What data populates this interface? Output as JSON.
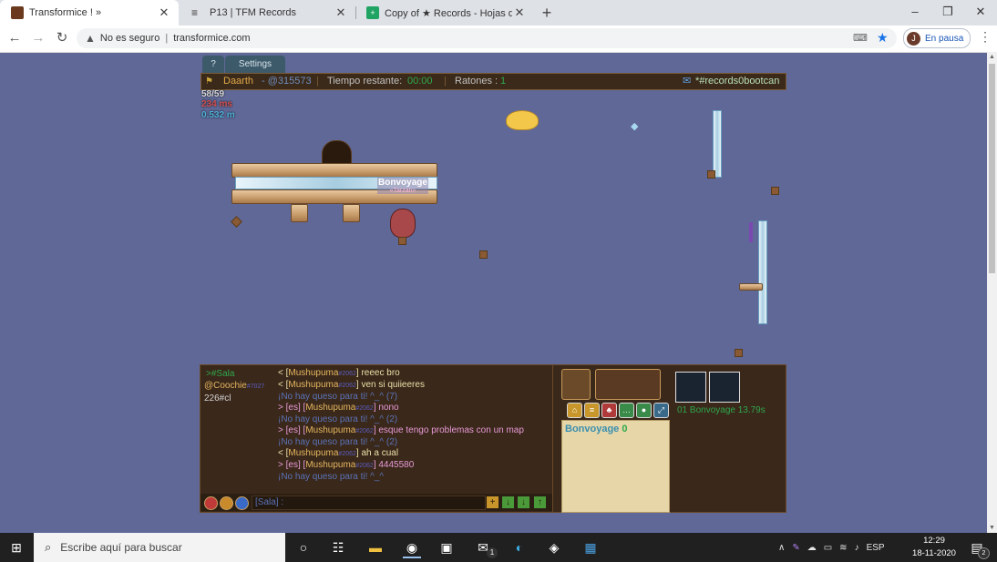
{
  "browser": {
    "tabs": [
      {
        "title": "Transformice ! »"
      },
      {
        "title": "P13 | TFM Records"
      },
      {
        "title": "Copy of ★ Records - Hojas de cá"
      }
    ],
    "new_tab": "+",
    "window": {
      "minimize": "–",
      "restore": "❐",
      "close": "✕"
    },
    "address": {
      "security": "No es seguro",
      "url": "transformice.com"
    },
    "profile": {
      "initial": "J",
      "status": "En pausa"
    }
  },
  "game": {
    "tabs": [
      "?",
      "Settings"
    ],
    "topbar": {
      "player": "Daarth",
      "player_tag": "- @315573",
      "time_label": "Tiempo restante:",
      "time_value": "00:00",
      "mice_label": "Ratones :",
      "mice_value": "1",
      "room": "*#records0bootcan"
    },
    "stats": {
      "fps": "58/59",
      "ping": "234 ms",
      "mem": "0.532 m"
    },
    "player_label": {
      "name": "Bonvoyage",
      "title": "«Tarzan»"
    },
    "chat": {
      "channels": [
        {
          "text": ">#Sala"
        },
        {
          "text": "@Coochie",
          "tag": "#7027"
        },
        {
          "text": "226#cl"
        }
      ],
      "lines": [
        {
          "dir": "<",
          "name": "Mushupuma",
          "tag": "#2062",
          "msg": "reeec bro"
        },
        {
          "dir": "<",
          "name": "Mushupuma",
          "tag": "#2062",
          "msg": "ven si quiieeres"
        },
        {
          "sys": "¡No hay queso para ti! ^_^ (7)"
        },
        {
          "dir": "> [es]",
          "name": "Mushupuma",
          "tag": "#2062",
          "msg": "nono"
        },
        {
          "sys": "¡No hay queso para ti! ^_^ (2)"
        },
        {
          "dir": "> [es]",
          "name": "Mushupuma",
          "tag": "#2062",
          "msg": "esque tengo problemas con un map"
        },
        {
          "sys": "¡No hay queso para ti! ^_^ (2)"
        },
        {
          "dir": "<",
          "name": "Mushupuma",
          "tag": "#2062",
          "msg": "ah a cual"
        },
        {
          "dir": "> [es]",
          "name": "Mushupuma",
          "tag": "#2062",
          "msg": "4445580"
        },
        {
          "sys": "¡No hay queso para ti! ^_^"
        }
      ],
      "input_placeholder": "[Sala] :"
    },
    "scoreboard": {
      "player": "Bonvoyage",
      "score": "0",
      "best_time": "01 Bonvoyage 13.79s"
    }
  },
  "taskbar": {
    "search_placeholder": "Escribe aquí para buscar",
    "lang": "ESP",
    "time": "12:29",
    "date": "18-11-2020",
    "mail_badge": "1",
    "notif_badge": "2"
  }
}
